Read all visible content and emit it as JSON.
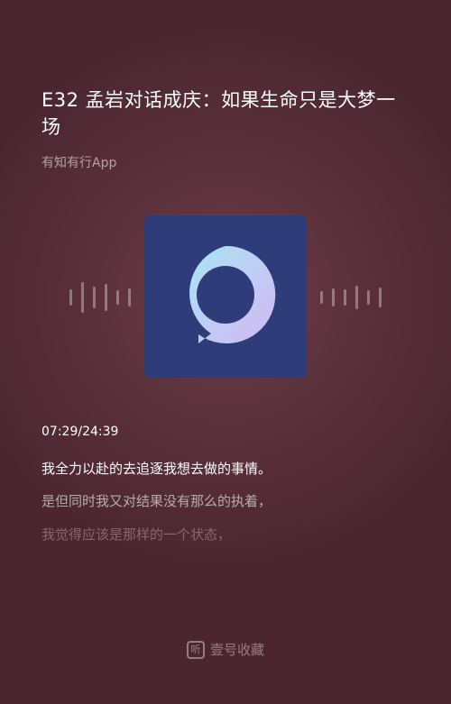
{
  "episode": {
    "title": "E32 孟岩对话成庆：如果生命只是大梦一场",
    "podcast": "有知有行App",
    "cover_icon": "speech-bubble-logo-icon"
  },
  "player": {
    "elapsed": "07:29",
    "duration": "24:39",
    "time_display": "07:29/24:39"
  },
  "lyrics": {
    "current": "我全力以赴的去追逐我想去做的事情。",
    "next": "是但同时我又对结果没有那么的执着，",
    "following": "我觉得应该是那样的一个状态，"
  },
  "watermark": {
    "icon_char": "听",
    "text": "壹号收藏"
  },
  "colors": {
    "background": "#5c323c",
    "cover_bg": "#2f3c7a",
    "logo_gradient_start": "#a9e3f6",
    "logo_gradient_end": "#d4b8f3"
  }
}
